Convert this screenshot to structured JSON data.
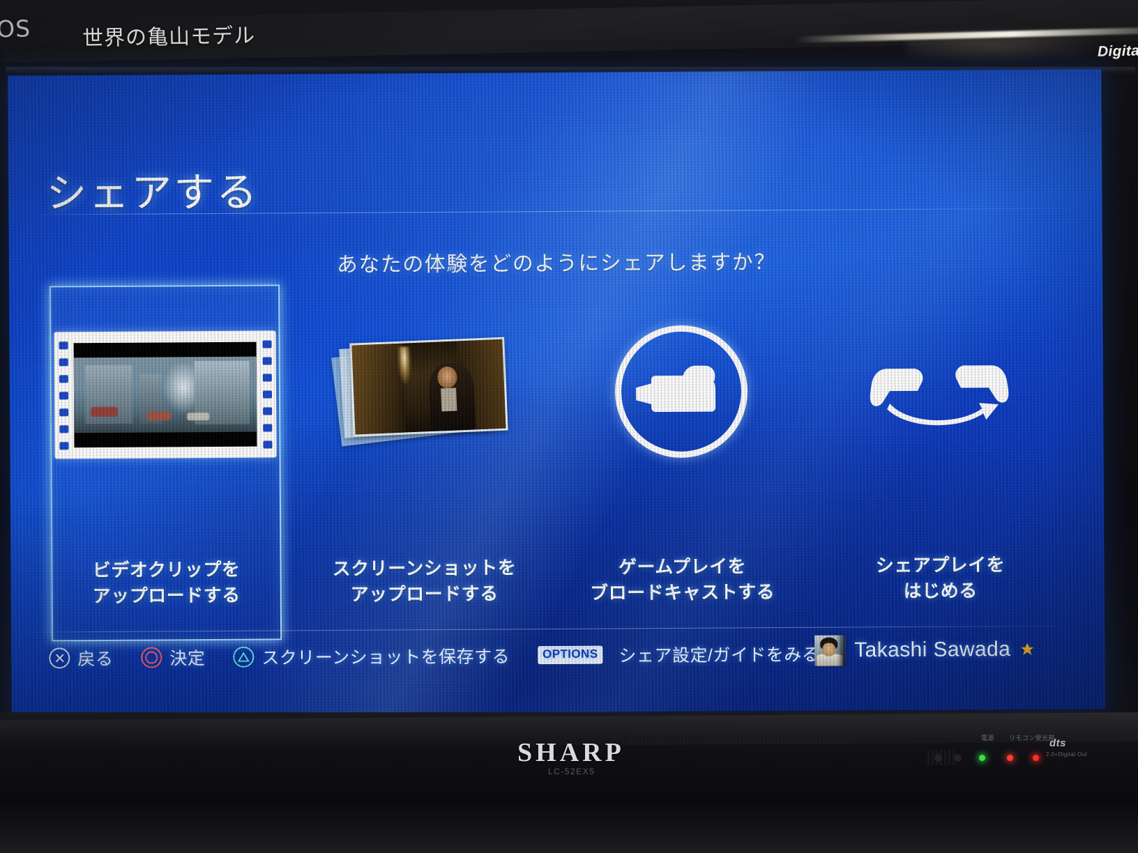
{
  "tv": {
    "brand_left": "UOS",
    "brand_tagline": "世界の亀山モデル",
    "brand_right": "Digital",
    "maker_logo": "SHARP",
    "model_text": "LC-52EX5",
    "panel_label_left": "電源",
    "panel_label_right": "リモコン受光部",
    "audio_logo": "dts",
    "audio_sub": "2.0+Digital Out"
  },
  "screen": {
    "title": "シェアする",
    "prompt": "あなたの体験をどのようにシェアしますか？",
    "accent_color": "#8ccfff",
    "background_color": "#0f46d2",
    "options": [
      {
        "id": "upload-video-clip",
        "icon": "film-strip-icon",
        "line1": "ビデオクリップを",
        "line2": "アップロードする",
        "selected": true
      },
      {
        "id": "upload-screenshot",
        "icon": "screenshot-stack-icon",
        "line1": "スクリーンショットを",
        "line2": "アップロードする",
        "selected": false
      },
      {
        "id": "broadcast-gameplay",
        "icon": "broadcast-camera-icon",
        "line1": "ゲームプレイを",
        "line2": "ブロードキャストする",
        "selected": false
      },
      {
        "id": "start-shareplay",
        "icon": "shareplay-controller-icon",
        "line1": "シェアプレイを",
        "line2": "はじめる",
        "selected": false
      }
    ],
    "footer": {
      "hints": [
        {
          "glyph": "cross-button-icon",
          "label": "戻る"
        },
        {
          "glyph": "circle-button-icon",
          "label": "決定"
        },
        {
          "glyph": "triangle-button-icon",
          "label": "スクリーンショットを保存する"
        }
      ],
      "options_chip": "OPTIONS",
      "options_label": "シェア設定/ガイドをみる",
      "user_name": "Takashi Sawada"
    }
  }
}
